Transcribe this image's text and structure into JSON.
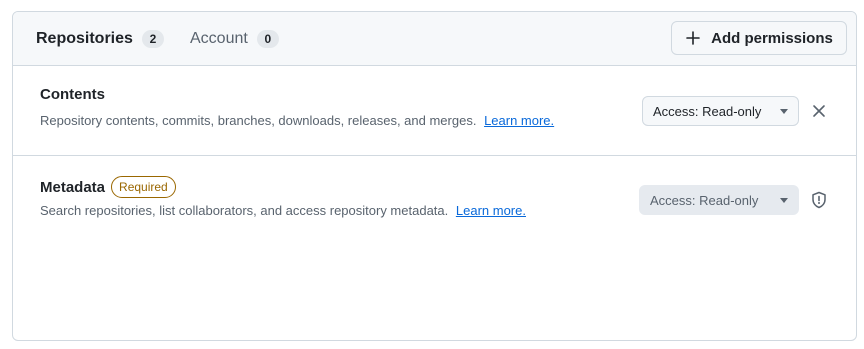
{
  "tabs": [
    {
      "label": "Repositories",
      "count": "2"
    },
    {
      "label": "Account",
      "count": "0"
    }
  ],
  "add_button": {
    "label": "Add permissions",
    "icon": "plus-icon"
  },
  "permissions": [
    {
      "title": "Contents",
      "description": "Repository contents, commits, branches, downloads, releases, and merges.",
      "link": "Learn more.",
      "access": "Access: Read-only",
      "action_icon": "close-icon"
    },
    {
      "title": "Metadata",
      "badge": "Required",
      "description": "Search repositories, list collaborators, and access repository metadata.",
      "link": "Learn more.",
      "access": "Access: Read-only",
      "action_icon": "shield-alert-icon"
    }
  ],
  "colors": {
    "link": "#0969da",
    "required_badge": "#9a6700",
    "border": "#d1d9e0",
    "header_bg": "#f6f8fa"
  }
}
